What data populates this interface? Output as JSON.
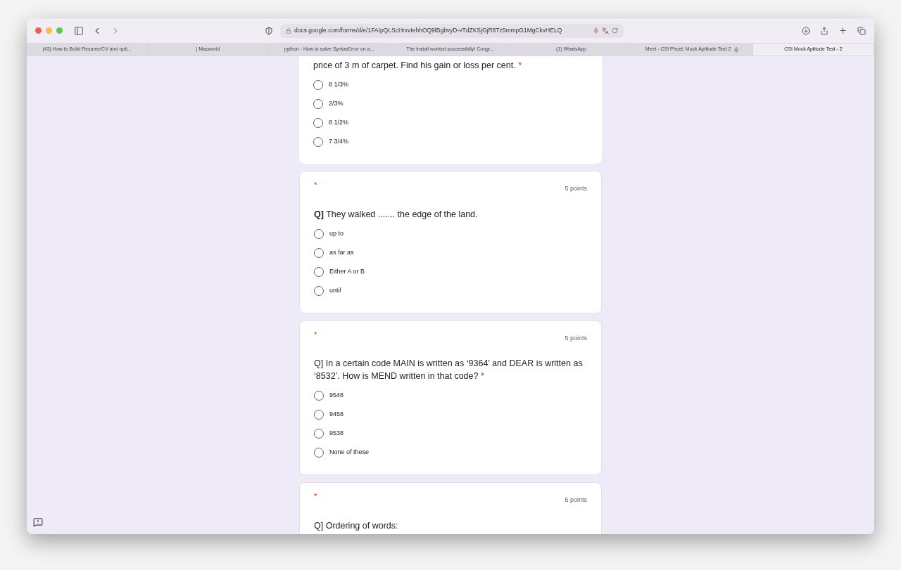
{
  "browser": {
    "url": "docs.google.com/forms/d/e/1FAIpQLScHrxvIehhOQ9lBgbvyD-vTdZKSjGjR8Tz5mmpG1MgCkvHELQ",
    "tabs": [
      {
        "title": "(43) How to Build Resume/CV and opti...",
        "selected": false,
        "audio": false
      },
      {
        "title": "| Macworld",
        "selected": false,
        "audio": false
      },
      {
        "title": "python - How to solve SyntaxError on a...",
        "selected": false,
        "audio": false
      },
      {
        "title": "The install worked successfully! Congr...",
        "selected": false,
        "audio": false
      },
      {
        "title": "(1) WhatsApp",
        "selected": false,
        "audio": false
      },
      {
        "title": "Meet - CSI Phcet: Mock Aptitude Test 2",
        "selected": false,
        "audio": true
      },
      {
        "title": "CSI Mock Aptitude Test - 2",
        "selected": true,
        "audio": false
      }
    ]
  },
  "form": {
    "questions": [
      {
        "text": "price of 3 m of carpet. Find his gain or loss per cent.",
        "required_mark": "*",
        "options": [
          {
            "label": "8 1/3%",
            "selected": false
          },
          {
            "label": "2/3%",
            "selected": false
          },
          {
            "label": "8 1/2%",
            "selected": false
          },
          {
            "label": "7 3/4%",
            "selected": false
          }
        ]
      },
      {
        "header": {
          "mark": "*",
          "points": "5 points"
        },
        "text": "**Q]** They walked ....... the edge of the land.",
        "options": [
          {
            "label": "up to",
            "selected": false
          },
          {
            "label": "as far as",
            "selected": false
          },
          {
            "label": "Either A or B",
            "selected": false
          },
          {
            "label": "until",
            "selected": false
          }
        ]
      },
      {
        "header": {
          "mark": "*",
          "points": "5 points"
        },
        "text": "Q] In a certain code MAIN is written as ‘9364’ and DEAR is written as ‘8532’. How is MEND written in that code?",
        "required_mark": "*",
        "options": [
          {
            "label": "9548",
            "selected": false
          },
          {
            "label": "9458",
            "selected": false
          },
          {
            "label": "9538",
            "selected": false
          },
          {
            "label": "None of these",
            "selected": false
          }
        ]
      },
      {
        "header": {
          "mark": "*",
          "points": "5 points"
        },
        "text": "Q] Ordering of words:"
      }
    ]
  }
}
